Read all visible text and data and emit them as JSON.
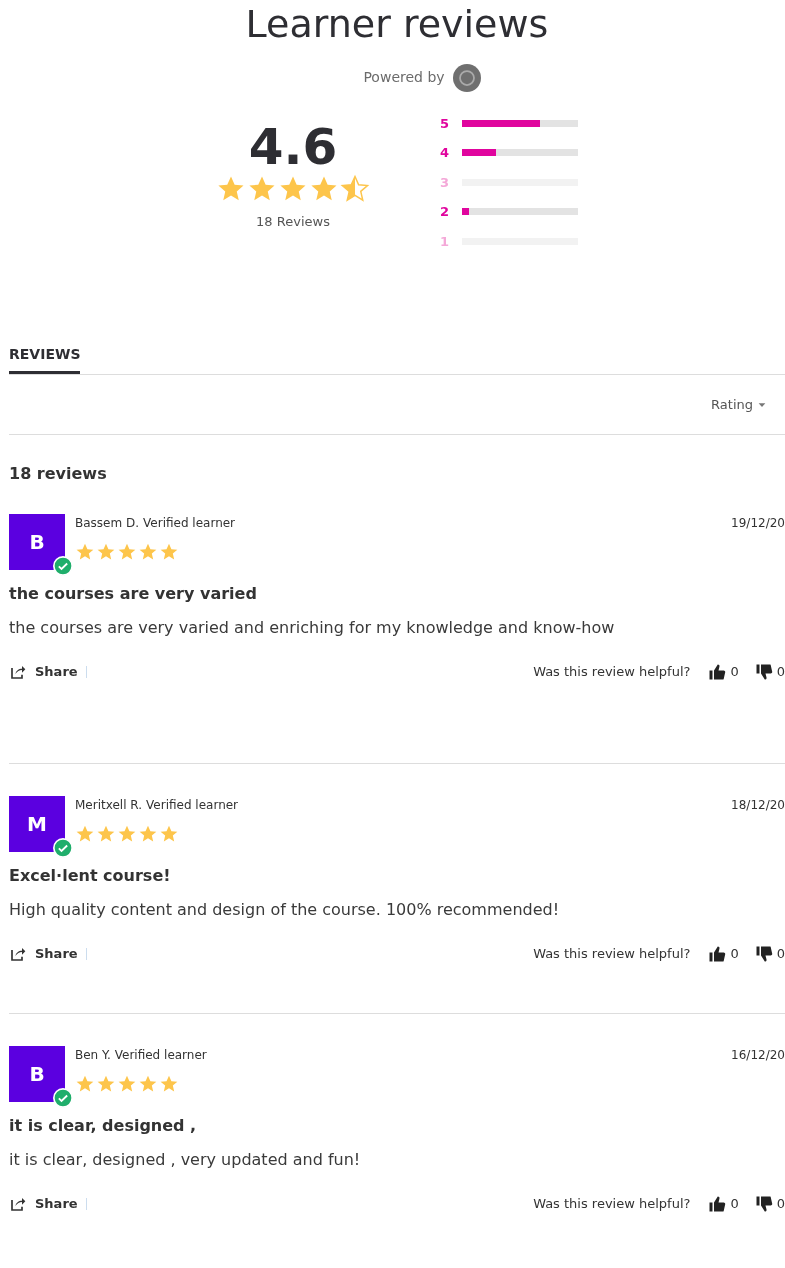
{
  "title": "Learner reviews",
  "powered_by": "Powered by",
  "summary": {
    "score": "4.6",
    "stars": 4.5,
    "count": "18 Reviews"
  },
  "distribution": [
    {
      "label": "5",
      "level": 0.67
    },
    {
      "label": "4",
      "level": 0.29
    },
    {
      "label": "3",
      "level": 0
    },
    {
      "label": "2",
      "level": 0.06
    },
    {
      "label": "1",
      "level": 0
    }
  ],
  "tabs": [
    {
      "label": "REVIEWS",
      "selected": true
    }
  ],
  "sort": {
    "label": "Rating"
  },
  "review_count": "18 reviews",
  "reviews": [
    {
      "initial": "B",
      "name": "Bassem D.",
      "badge": "Verified learner",
      "verified": true,
      "date": "19/12/20",
      "stars": 5,
      "title": "the courses are very varied",
      "body": "the courses are very varied and enriching for my knowledge and know-how",
      "share": "Share",
      "helpful": "Was this review helpful?",
      "up": "0",
      "down": "0"
    },
    {
      "initial": "M",
      "name": "Meritxell R.",
      "badge": "Verified learner",
      "verified": true,
      "date": "18/12/20",
      "stars": 5,
      "title": "Excel·lent course!",
      "body": "High quality content and design of the course. 100% recommended!",
      "share": "Share",
      "helpful": "Was this review helpful?",
      "up": "0",
      "down": "0"
    },
    {
      "initial": "B",
      "name": "Ben Y.",
      "badge": "Verified learner",
      "verified": true,
      "date": "16/12/20",
      "stars": 5,
      "title": "it is clear, designed ,",
      "body": "it is clear, designed , very updated and fun!",
      "share": "Share",
      "helpful": "Was this review helpful?",
      "up": "0",
      "down": "0"
    }
  ]
}
